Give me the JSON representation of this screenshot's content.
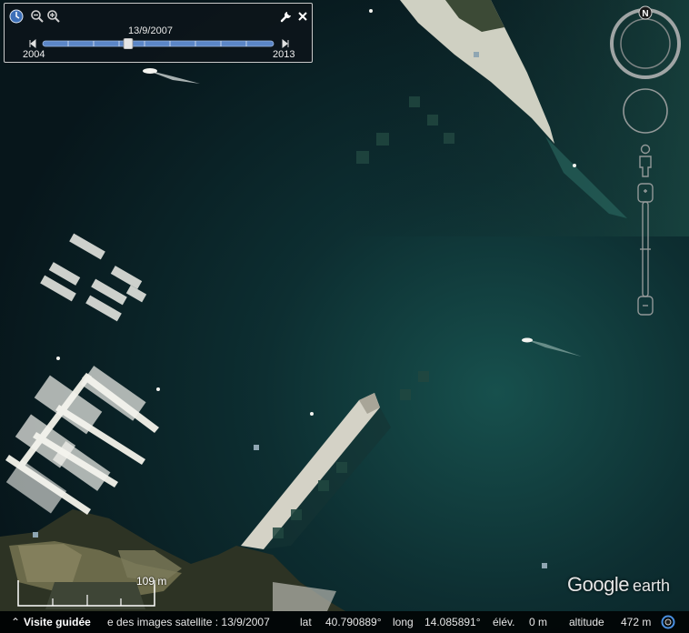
{
  "time_slider": {
    "current_date": "13/9/2007",
    "start_year": "2004",
    "end_year": "2013",
    "position_fraction": 0.37,
    "icons": [
      "clock-icon",
      "zoom-out-icon",
      "zoom-in-icon",
      "wrench-icon",
      "close-icon"
    ]
  },
  "navigation": {
    "north_label": "N",
    "icons": [
      "compass-ring-icon",
      "look-joystick-icon",
      "pegman-icon",
      "zoom-slider-icon"
    ]
  },
  "scale": {
    "label": "109 m"
  },
  "logo": {
    "google": "Google",
    "earth": "earth"
  },
  "status_bar": {
    "tour_label": "Visite guidée",
    "imagery_date": "e des images satellite : 13/9/2007",
    "lat_key": "lat",
    "lat_value": "40.790889°",
    "long_key": "long",
    "long_value": "14.085891°",
    "elev_key": "élév.",
    "elev_value": "0 m",
    "alt_key": "altitude",
    "alt_value": "472 m"
  },
  "colors": {
    "sea_deep": "#06141a",
    "sea_mid": "#0f3638",
    "sea_light": "#1f5a55",
    "land": "#3a3a2a",
    "panel_bg": "#0c141a",
    "slider_track": "#5b86c7"
  }
}
